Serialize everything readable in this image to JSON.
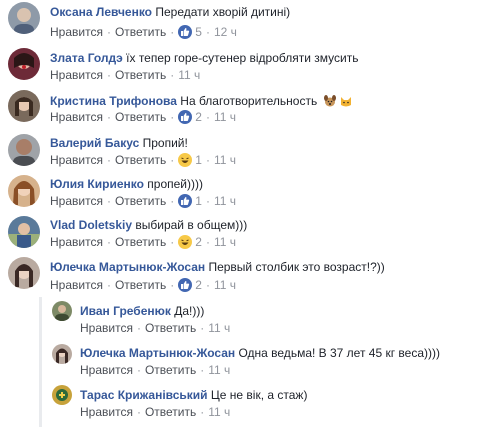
{
  "actions": {
    "like": "Нравится",
    "reply": "Ответить",
    "dot": "·"
  },
  "comments": [
    {
      "author": "Оксана Левченко",
      "text": "Передати хворій дитині)",
      "reactions": "5",
      "time": "12 ч",
      "avatar_color": "#8e9aa8",
      "reaction_icons": [
        "like-icon"
      ]
    },
    {
      "author": "Злата Голдэ",
      "text": "їх тепер горе-сутенер відробляти змусить",
      "reactions": "",
      "time": "11 ч",
      "avatar_color": "#6d2a38",
      "reaction_icons": []
    },
    {
      "author": "Кристина Трифонова",
      "text": "На благотворительность",
      "reactions": "2",
      "time": "11 ч",
      "avatar_color": "#7a6a5c",
      "reaction_icons": [
        "like-icon"
      ],
      "emojis": [
        "dog-emoji",
        "cat-emoji"
      ]
    },
    {
      "author": "Валерий Бакус",
      "text": "Пропий!",
      "reactions": "1",
      "time": "11 ч",
      "avatar_color": "#6b6e72",
      "reaction_icons": [
        "haha-icon"
      ]
    },
    {
      "author": "Юлия Кириенко",
      "text": "пропей))))",
      "reactions": "1",
      "time": "11 ч",
      "avatar_color": "#b87b54",
      "reaction_icons": [
        "like-icon"
      ]
    },
    {
      "author": "Vlad Doletskiy",
      "text": "выбирай в общем)))",
      "reactions": "2",
      "time": "11 ч",
      "avatar_color": "#5a7a9a",
      "reaction_icons": [
        "haha-icon"
      ]
    },
    {
      "author": "Юлечка Мартынюк-Жосан",
      "text": "Первый столбик это возраст!?))",
      "reactions": "2",
      "time": "11 ч",
      "avatar_color": "#8c7a70",
      "reaction_icons": [
        "like-icon"
      ]
    }
  ],
  "replies": [
    {
      "author": "Иван Гребенюк",
      "text": "Да!)))",
      "reactions": "",
      "time": "11 ч",
      "avatar_color": "#7d8a66",
      "reaction_icons": []
    },
    {
      "author": "Юлечка Мартынюк-Жосан",
      "text": "Одна ведьма! В 37 лет 45 кг веса))))",
      "reactions": "",
      "time": "11 ч",
      "avatar_color": "#8c7a70",
      "reaction_icons": []
    },
    {
      "author": "Тарас Крижанівський",
      "text": "Це не вік, а стаж)",
      "reactions": "",
      "time": "11 ч",
      "avatar_color": "#c7a23a",
      "reaction_icons": []
    }
  ]
}
